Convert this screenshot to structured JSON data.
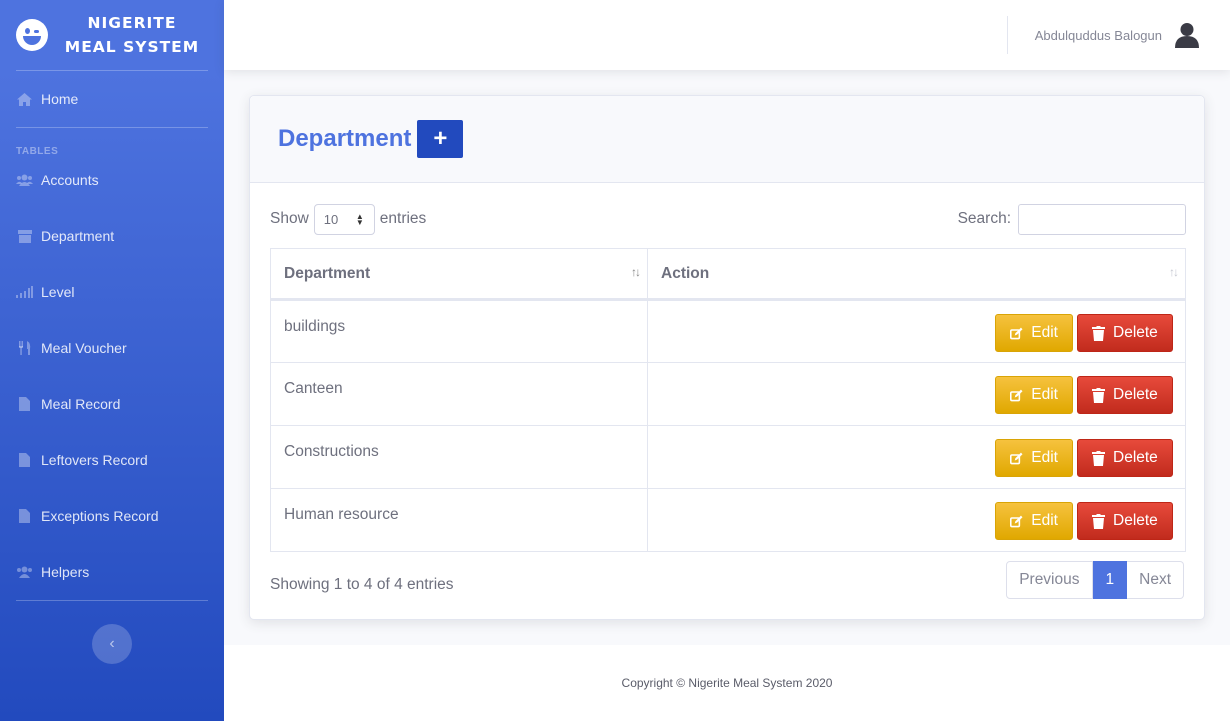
{
  "brand": {
    "line1": "NIGERITE",
    "line2": "MEAL SYSTEM"
  },
  "sidebar": {
    "home": "Home",
    "heading": "TABLES",
    "items": [
      {
        "label": "Accounts",
        "icon": "users-icon"
      },
      {
        "label": "Department",
        "icon": "archive-icon"
      },
      {
        "label": "Level",
        "icon": "signal-icon"
      },
      {
        "label": "Meal Voucher",
        "icon": "utensils-icon"
      },
      {
        "label": "Meal Record",
        "icon": "file-icon"
      },
      {
        "label": "Leftovers Record",
        "icon": "file-icon"
      },
      {
        "label": "Exceptions Record",
        "icon": "file-icon"
      },
      {
        "label": "Helpers",
        "icon": "users-icon"
      }
    ],
    "toggle": "‹"
  },
  "topbar": {
    "username": "Abdulquddus Balogun"
  },
  "card": {
    "title": "Department",
    "add_label": "+",
    "show_label": "Show",
    "entries_value": "10",
    "entries_label": "entries",
    "search_label": "Search:",
    "search_value": ""
  },
  "table": {
    "headers": [
      "Department",
      "Action"
    ],
    "rows": [
      {
        "department": "buildings"
      },
      {
        "department": "Canteen"
      },
      {
        "department": "Constructions"
      },
      {
        "department": "Human resource"
      }
    ],
    "edit_label": "Edit",
    "delete_label": "Delete"
  },
  "pagination": {
    "info": "Showing 1 to 4 of 4 entries",
    "previous": "Previous",
    "current": "1",
    "next": "Next"
  },
  "footer": {
    "text": "Copyright © Nigerite Meal System 2020"
  },
  "colors": {
    "primary": "#4e73df",
    "warning": "#f6c23e",
    "danger": "#e74a3b"
  }
}
